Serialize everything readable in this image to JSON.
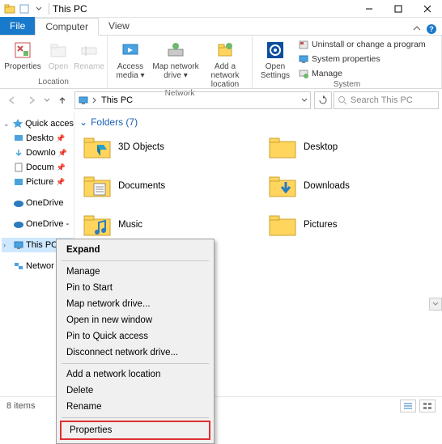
{
  "title": "This PC",
  "tabs": {
    "file": "File",
    "computer": "Computer",
    "view": "View"
  },
  "ribbon": {
    "location": {
      "label": "Location",
      "properties": "Properties",
      "open": "Open",
      "rename": "Rename"
    },
    "network": {
      "label": "Network",
      "access_media": "Access media ▾",
      "map_drive": "Map network drive ▾",
      "add_location": "Add a network location"
    },
    "system": {
      "label": "System",
      "open_settings": "Open Settings",
      "uninstall": "Uninstall or change a program",
      "properties": "System properties",
      "manage": "Manage"
    }
  },
  "address": {
    "location": "This PC"
  },
  "search": {
    "placeholder": "Search This PC"
  },
  "tree": {
    "quick_access": "Quick acces",
    "desktop": "Deskto",
    "downloads": "Downlo",
    "documents": "Docum",
    "pictures": "Picture",
    "onedrive": "OneDrive",
    "onedrive2": "OneDrive -",
    "this_pc": "This PC",
    "network": "Networ"
  },
  "content": {
    "section": "Folders (7)",
    "items": [
      {
        "name": "3D Objects"
      },
      {
        "name": "Desktop"
      },
      {
        "name": "Documents"
      },
      {
        "name": "Downloads"
      },
      {
        "name": "Music"
      },
      {
        "name": "Pictures"
      }
    ]
  },
  "context_menu": {
    "expand": "Expand",
    "manage": "Manage",
    "pin_start": "Pin to Start",
    "map_drive": "Map network drive...",
    "open_new_window": "Open in new window",
    "pin_quick": "Pin to Quick access",
    "disconnect": "Disconnect network drive...",
    "add_location": "Add a network location",
    "delete": "Delete",
    "rename": "Rename",
    "properties": "Properties"
  },
  "status": {
    "items": "8 items"
  }
}
